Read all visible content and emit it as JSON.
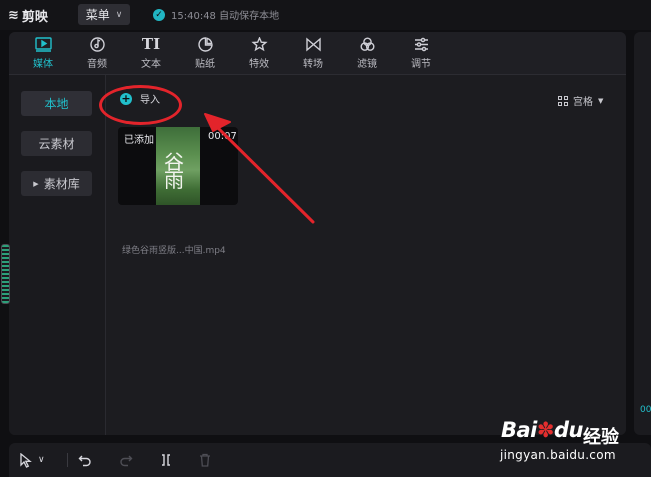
{
  "app": {
    "name": "剪映",
    "logo_icon": "jianying-logo-icon"
  },
  "topbar": {
    "menu_label": "菜单",
    "saved_status": "15:40:48 自动保存本地"
  },
  "tabs": [
    {
      "label": "媒体",
      "icon": "media-play-icon",
      "active": true
    },
    {
      "label": "音频",
      "icon": "audio-note-icon"
    },
    {
      "label": "文本",
      "icon": "text-ti-icon",
      "glyph": "TI"
    },
    {
      "label": "贴纸",
      "icon": "sticker-icon"
    },
    {
      "label": "特效",
      "icon": "effects-star-icon"
    },
    {
      "label": "转场",
      "icon": "transition-bowtie-icon"
    },
    {
      "label": "滤镜",
      "icon": "filter-circles-icon"
    },
    {
      "label": "调节",
      "icon": "adjust-sliders-icon"
    }
  ],
  "sidebar": {
    "local": "本地",
    "cloud": "云素材",
    "library": "素材库"
  },
  "content": {
    "import_label": "导入",
    "view_label": "宫格",
    "media": {
      "added_label": "已添加",
      "duration": "00:07",
      "filename": "绿色谷雨竖版...中国.mp4",
      "thumb_text": "谷雨"
    }
  },
  "right_panel_text": "00",
  "watermark": {
    "brand": "Bai",
    "brand2": "du",
    "jingyan": "经验",
    "url": "jingyan.baidu.com"
  },
  "colors": {
    "accent": "#21c0cc",
    "annotation_red": "#e3242b",
    "background": "#0f0f12"
  }
}
